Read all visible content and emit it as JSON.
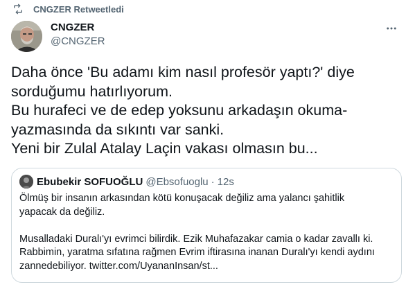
{
  "retweet": {
    "label": "CNGZER Retweetledi",
    "icon": "retweet-icon"
  },
  "author": {
    "display_name": "CNGZER",
    "handle": "@CNGZER",
    "avatar_icon": "avatar"
  },
  "tweet": {
    "lines": [
      "Daha önce 'Bu adamı kim nasıl profesör yaptı?' diye",
      "sorduğumu hatırlıyorum.",
      "Bu hurafeci ve de edep yoksunu arkadaşın okuma-",
      "yazmasında da sıkıntı var sanki.",
      "Yeni bir Zulal Atalay Laçin vakası olmasın bu..."
    ]
  },
  "quote": {
    "display_name": "Ebubekir SOFUOĞLU",
    "handle": "@Ebsofuoglu",
    "dot": "·",
    "time": "12s",
    "paragraph1": [
      "Ölmüş bir insanın arkasından kötü konuşacak değiliz ama yalancı şahitlik",
      "yapacak da değiliz."
    ],
    "paragraph2": [
      "Musalladaki Duralı'yı evrimci bilirdik. Ezik Muhafazakar camia o kadar zavallı ki.",
      "Rabbimin, yaratma sıfatına rağmen Evrim iftirasına inanan Duralı'yı kendi aydını",
      "zannedebiliyor. twitter.com/UyananInsan/st..."
    ]
  },
  "colors": {
    "text": "#0f1419",
    "secondary": "#536471",
    "border": "#cfd9de"
  }
}
